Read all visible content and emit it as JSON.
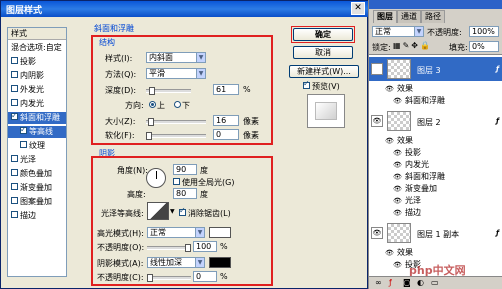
{
  "dialog": {
    "title": "图层样式",
    "close_glyph": "✕",
    "styles_header": "样式",
    "blend_options": "混合选项:自定",
    "style_items": [
      {
        "label": "投影",
        "checked": false
      },
      {
        "label": "内阴影",
        "checked": false
      },
      {
        "label": "外发光",
        "checked": false
      },
      {
        "label": "内发光",
        "checked": false
      },
      {
        "label": "斜面和浮雕",
        "checked": true,
        "selected": true
      },
      {
        "label": "等高线",
        "checked": true,
        "sub": true,
        "subselected": true
      },
      {
        "label": "纹理",
        "checked": false,
        "sub": true
      },
      {
        "label": "光泽",
        "checked": false
      },
      {
        "label": "颜色叠加",
        "checked": false
      },
      {
        "label": "渐变叠加",
        "checked": false
      },
      {
        "label": "图案叠加",
        "checked": false
      },
      {
        "label": "描边",
        "checked": false
      }
    ],
    "bevel": {
      "section_title": "斜面和浮雕",
      "structure_title": "结构",
      "style_label": "样式(I):",
      "style_value": "内斜面",
      "method_label": "方法(Q):",
      "method_value": "平滑",
      "depth_label": "深度(D):",
      "depth_value": "61",
      "depth_fraction": 0.061,
      "depth_unit": "%",
      "direction_label": "方向:",
      "direction_up": "上",
      "direction_down": "下",
      "size_label": "大小(Z):",
      "size_value": "16",
      "size_unit": "像素",
      "soften_label": "软化(F):",
      "soften_value": "0",
      "soften_unit": "像素"
    },
    "shading": {
      "title": "阴影",
      "angle_label": "角度(N):",
      "angle_value": "90",
      "angle_unit": "度",
      "global_light_label": "使用全局光(G)",
      "altitude_label": "高度:",
      "altitude_value": "80",
      "altitude_unit": "度",
      "gloss_label": "光泽等高线:",
      "antialias_label": "消除锯齿(L)",
      "highlight_mode_label": "高光模式(H):",
      "highlight_mode_value": "正常",
      "highlight_opacity_label": "不透明度(O):",
      "highlight_opacity_value": "100",
      "shadow_mode_label": "阴影模式(A):",
      "shadow_mode_value": "线性加深",
      "shadow_opacity_label": "不透明度(C):",
      "shadow_opacity_value": "0",
      "percent": "%"
    },
    "buttons": {
      "ok": "确定",
      "cancel": "取消",
      "new_style": "新建样式(W)...",
      "preview": "预览(V)"
    }
  },
  "layers_panel": {
    "tabs": [
      "图层",
      "通道",
      "路径"
    ],
    "blend_mode": "正常",
    "opacity_label": "不透明度:",
    "opacity_value": "100%",
    "lock_label": "锁定:",
    "fill_label": "填充:",
    "fill_value": "0%",
    "layers": [
      {
        "name": "图层 3",
        "effects_label": "效果",
        "effects": [
          "斜面和浮雕"
        ],
        "selected": true
      },
      {
        "name": "图层 2",
        "effects_label": "效果",
        "effects": [
          "投影",
          "内发光",
          "斜面和浮雕",
          "渐变叠加",
          "光泽",
          "描边"
        ]
      },
      {
        "name": "图层 1 副本",
        "effects_label": "效果",
        "effects": [
          "投影"
        ]
      }
    ],
    "fx_glyph": "ƒ",
    "eye_glyph": "👁",
    "watermark": "php中文网"
  },
  "colors": {
    "accent_red": "#e02020",
    "title_blue": "#0a56d8",
    "selection_blue": "#316ac5"
  }
}
